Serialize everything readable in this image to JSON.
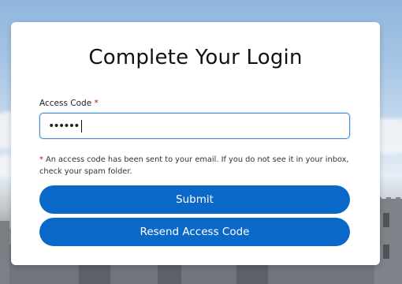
{
  "login": {
    "title": "Complete Your Login",
    "access_code_label": "Access Code",
    "required_marker": "*",
    "access_code_value": "••••••",
    "note_marker": "*",
    "note_text": " An access code has been sent to your email. If you do not see it in your inbox, check your spam folder.",
    "submit_label": "Submit",
    "resend_label": "Resend Access Code"
  },
  "colors": {
    "primary_button": "#0a69c8",
    "required": "#d0021b",
    "input_focus_border": "#4a90d9"
  }
}
